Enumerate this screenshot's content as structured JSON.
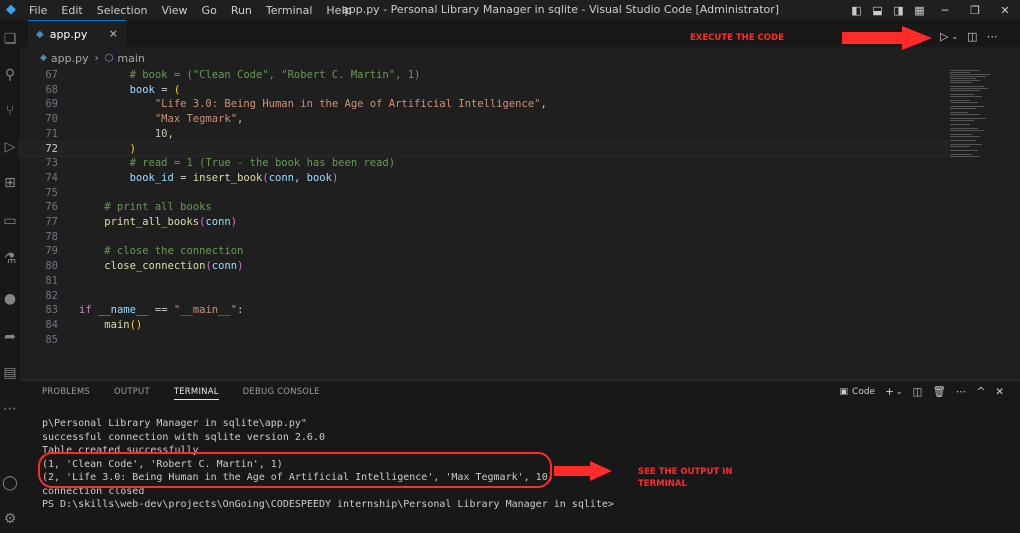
{
  "menu": [
    "File",
    "Edit",
    "Selection",
    "View",
    "Go",
    "Run",
    "Terminal",
    "Help"
  ],
  "window_title": "app.py - Personal Library Manager in sqlite - Visual Studio Code [Administrator]",
  "tab": {
    "label": "app.py",
    "close": "×"
  },
  "breadcrumb": {
    "file": "app.py",
    "symbol": "main"
  },
  "editor": {
    "lines": [
      {
        "n": "67",
        "html": "<span class=\"cm\">        # book = (\"Clean Code\", \"Robert C. Martin\", 1)</span>"
      },
      {
        "n": "68",
        "html": "        <span class=\"var\">book</span> = <span class=\"br2\">(</span>"
      },
      {
        "n": "69",
        "html": "            <span class=\"str\">\"Life 3.0: Being Human in the Age of Artificial Intelligence\"</span>,"
      },
      {
        "n": "70",
        "html": "            <span class=\"str\">\"Max Tegmark\"</span>,"
      },
      {
        "n": "71",
        "html": "            <span class=\"num\">10</span>,"
      },
      {
        "n": "72",
        "html": "        <span class=\"br2\">)</span>",
        "current": true
      },
      {
        "n": "73",
        "html": "<span class=\"cm\">        # read = 1 (True - the book has been read)</span>"
      },
      {
        "n": "74",
        "html": "        <span class=\"var\">book_id</span> = <span class=\"fn\">insert_book</span><span class=\"br\">(</span><span class=\"var\">conn</span>, <span class=\"var\">book</span><span class=\"br\">)</span>"
      },
      {
        "n": "75",
        "html": ""
      },
      {
        "n": "76",
        "html": "<span class=\"cm\">    # print all books</span>"
      },
      {
        "n": "77",
        "html": "    <span class=\"fn\">print_all_books</span><span class=\"br\">(</span><span class=\"var\">conn</span><span class=\"br\">)</span>"
      },
      {
        "n": "78",
        "html": ""
      },
      {
        "n": "79",
        "html": "<span class=\"cm\">    # close the connection</span>"
      },
      {
        "n": "80",
        "html": "    <span class=\"fn\">close_connection</span><span class=\"br\">(</span><span class=\"var\">conn</span><span class=\"br\">)</span>"
      },
      {
        "n": "81",
        "html": ""
      },
      {
        "n": "82",
        "html": ""
      },
      {
        "n": "83",
        "html": "<span class=\"kw\">if</span> <span class=\"var\">__name__</span> == <span class=\"str\">\"__main__\"</span>:"
      },
      {
        "n": "84",
        "html": "    <span class=\"fn\">main</span><span class=\"br2\">()</span>"
      },
      {
        "n": "85",
        "html": ""
      }
    ]
  },
  "annotations": {
    "execute": "EXECUTE THE CODE",
    "output_line1": "SEE THE OUTPUT IN",
    "output_line2": "TERMINAL"
  },
  "panel": {
    "tabs": [
      "PROBLEMS",
      "OUTPUT",
      "TERMINAL",
      "DEBUG CONSOLE"
    ],
    "active_tab": "TERMINAL",
    "terminal_profile": "Code"
  },
  "terminal": {
    "lines": [
      "p\\Personal Library Manager in sqlite\\app.py\"",
      "successful connection with sqlite version 2.6.0",
      "Table created successfully",
      "(1, 'Clean Code', 'Robert C. Martin', 1)",
      "(2, 'Life 3.0: Being Human in the Age of Artificial Intelligence', 'Max Tegmark', 10)",
      "connection closed",
      "PS D:\\skills\\web-dev\\projects\\OnGoing\\CODESPEEDY internship\\Personal Library Manager in sqlite>"
    ]
  },
  "colors": {
    "accent": "#0078d4",
    "annotation": "#ff2b2b"
  }
}
